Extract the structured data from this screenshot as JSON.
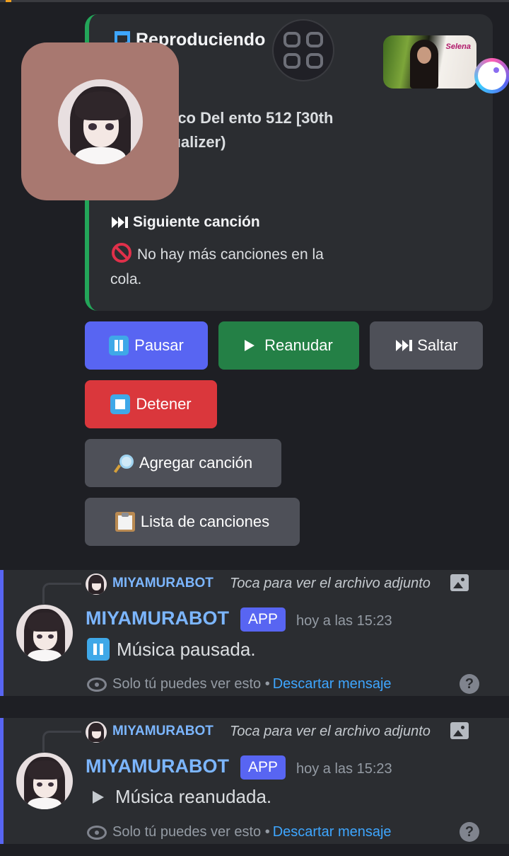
{
  "embed": {
    "title": "Reproduciendo",
    "song": "n - El Chico Del ento 512 [30th ary] (Visualizer)",
    "artist": "a",
    "next_title": "Siguiente canción",
    "next_text": "No hay más canciones en la cola."
  },
  "buttons": {
    "pause": "Pausar",
    "resume": "Reanudar",
    "skip": "Saltar",
    "stop": "Detener",
    "add_song": "Agregar canción",
    "song_list": "Lista de canciones"
  },
  "messages": [
    {
      "reply_name": "MIYAMURABOT",
      "reply_text": "Toca para ver el archivo adjunto",
      "author": "MIYAMURABOT",
      "badge": "APP",
      "time": "hoy a las 15:23",
      "text": "Música pausada.",
      "footer_text": "Solo tú puedes ver esto •",
      "footer_link": "Descartar mensaje",
      "help": "?"
    },
    {
      "reply_name": "MIYAMURABOT",
      "reply_text": "Toca para ver el archivo adjunto",
      "author": "MIYAMURABOT",
      "badge": "APP",
      "time": "hoy a las 15:23",
      "text": "Música reanudada.",
      "footer_text": "Solo tú puedes ver esto •",
      "footer_link": "Descartar mensaje",
      "help": "?"
    }
  ],
  "thumbnail": {
    "logo": "Selena"
  },
  "icons": {
    "music_note": "music-note-icon",
    "grid": "grid-icon",
    "skip": "next-track-icon",
    "no_entry": "no-entry-icon",
    "pause": "pause-icon",
    "play": "play-icon",
    "stop": "stop-icon",
    "search": "magnifier-icon",
    "clipboard": "clipboard-icon",
    "eye": "eye-icon",
    "image": "image-icon",
    "help": "help-icon"
  },
  "colors": {
    "accent": "#5865f2",
    "success": "#248046",
    "danger": "#da373c",
    "secondary": "#4e5058",
    "embed_bar": "#23a559",
    "link": "#3ea6ff",
    "username": "#7cb6ff"
  }
}
